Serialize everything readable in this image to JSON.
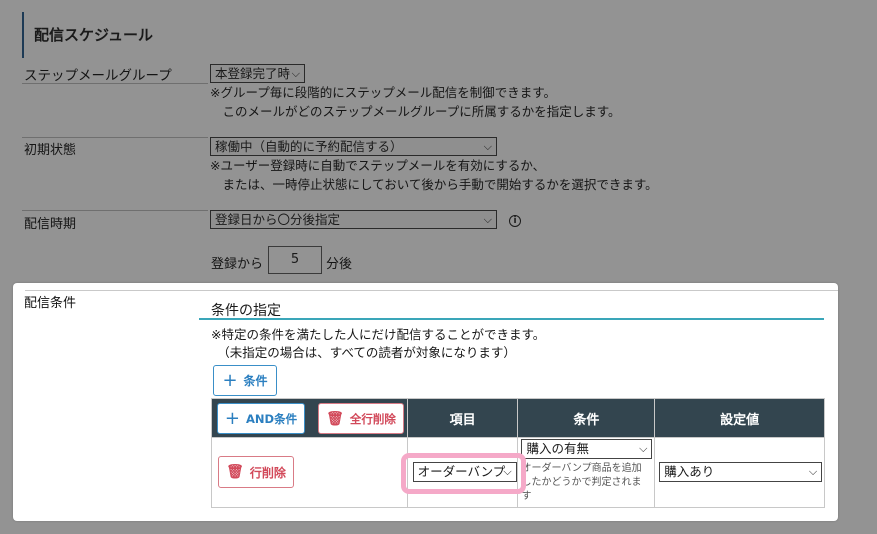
{
  "section": {
    "title": "配信スケジュール"
  },
  "rows": {
    "group": {
      "label": "ステップメールグループ",
      "select_value": "本登録完了時",
      "note": "※グループ毎に段階的にステップメール配信を制御できます。\n　このメールがどのステップメールグループに所属するかを指定します。"
    },
    "initial": {
      "label": "初期状態",
      "select_value": "稼働中（自動的に予約配信する）",
      "note": "※ユーザー登録時に自動でステップメールを有効にするか、\n　または、一時停止状態にしておいて後から手動で開始するかを選択できます。"
    },
    "timing": {
      "label": "配信時期",
      "select_value": "登録日から〇分後指定",
      "from_label": "登録から",
      "minutes_value": "5",
      "after_label": "分後"
    }
  },
  "conditions": {
    "label": "配信条件",
    "subtitle": "条件の指定",
    "note": "※特定の条件を満たした人にだけ配信することができます。\n　（未指定の場合は、すべての読者が対象になります）",
    "add_button": "条件",
    "and_button": "AND条件",
    "delete_all_button": "全行削除",
    "headers": {
      "item": "項目",
      "condition": "条件",
      "value": "設定値"
    },
    "row": {
      "delete_button": "行削除",
      "item_value": "オーダーバンプ",
      "condition_value": "購入の有無",
      "condition_note": "オーダーバンプ商品を追加\nしたかどうかで判定されま\nす",
      "setting_value": "購入あり"
    }
  },
  "colors": {
    "header_bg": "#33454f",
    "accent_blue": "#2b7fc0",
    "accent_red": "#d2495a",
    "highlight_pink": "#f5a9c8",
    "underline_teal": "#3aa6b9"
  },
  "icons": [
    "info-icon",
    "plus-icon",
    "trash-icon",
    "chevron-down-icon"
  ]
}
